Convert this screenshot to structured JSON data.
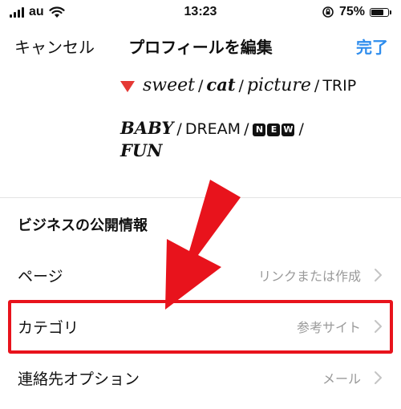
{
  "status_bar": {
    "carrier": "au",
    "time": "13:23",
    "battery_percent_text": "75%",
    "battery_level": 0.75,
    "icons": [
      "signal-icon",
      "wifi-icon",
      "orientation-lock-icon",
      "battery-icon"
    ]
  },
  "nav": {
    "cancel_label": "キャンセル",
    "title": "プロフィールを編集",
    "done_label": "完了",
    "done_color": "#2f8ded"
  },
  "bio": {
    "line1": {
      "sweet": "sweet",
      "sep1": "/",
      "cat": "cat",
      "sep2": "/",
      "picture": "picture",
      "sep3": "/",
      "trip": "TRIP"
    },
    "line2": {
      "baby": "BABY",
      "sep1": "/",
      "dream": "DREAM",
      "sep2": "/",
      "new_letters": [
        "N",
        "E",
        "W"
      ],
      "sep3": "/"
    },
    "line3": {
      "fun": "FUN"
    },
    "triangle_color": "#e53935"
  },
  "business": {
    "section_title": "ビジネスの公開情報",
    "rows": [
      {
        "label": "ページ",
        "value": "リンクまたは作成"
      },
      {
        "label": "カテゴリ",
        "value": "参考サイト"
      },
      {
        "label": "連絡先オプション",
        "value": "メール"
      }
    ]
  },
  "annotation": {
    "highlight_color": "#e8131c",
    "arrow_color": "#e8131c"
  }
}
